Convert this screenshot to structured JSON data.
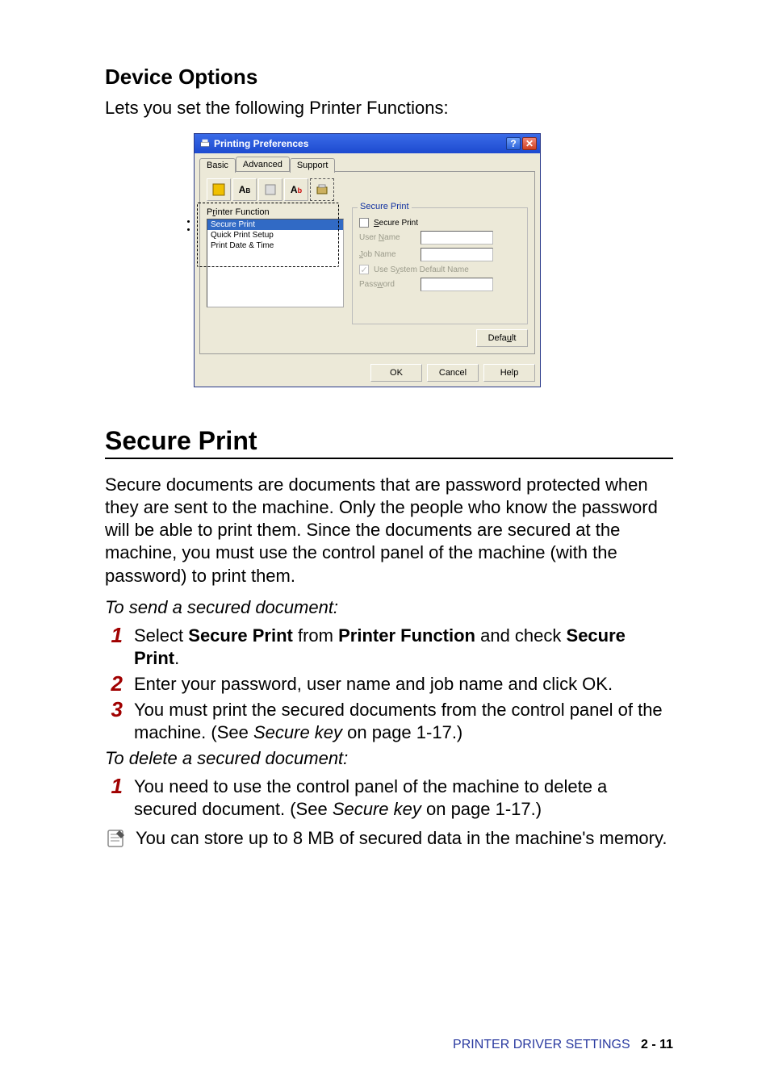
{
  "headings": {
    "device_options": "Device Options",
    "secure_print": "Secure Print"
  },
  "intro": "Lets you set the following Printer Functions:",
  "dialog": {
    "title": "Printing Preferences",
    "tabs": {
      "basic": "Basic",
      "advanced": "Advanced",
      "support": "Support"
    },
    "printer_function_label_pre": "P",
    "printer_function_label_ul": "r",
    "printer_function_label_post": "inter Function",
    "list": {
      "secure_print": "Secure Print",
      "quick_print_setup": "Quick Print Setup",
      "print_date_time": "Print Date & Time"
    },
    "group": {
      "legend": "Secure Print",
      "secure_print_chk_pre": "",
      "secure_print_chk_ul": "S",
      "secure_print_chk_post": "ecure Print",
      "user_name_pre": "User ",
      "user_name_ul": "N",
      "user_name_post": "ame",
      "job_name_pre": "",
      "job_name_ul": "J",
      "job_name_post": "ob Name",
      "use_default_pre": "Use S",
      "use_default_ul": "y",
      "use_default_post": "stem Default Name",
      "password_pre": "Pass",
      "password_ul": "w",
      "password_post": "ord"
    },
    "buttons": {
      "default": "Defa",
      "default_ul": "u",
      "default_post": "lt",
      "ok": "OK",
      "cancel": "Cancel",
      "help": "Help"
    }
  },
  "secure_para": "Secure documents are documents that are password protected when they are sent to the machine. Only the people who know the password will be able to print them. Since the documents are secured at the machine, you must use the control panel of the machine (with the password) to print them.",
  "send_title": "To send a secured document:",
  "send_steps": {
    "s1_a": "Select ",
    "s1_b1": "Secure Print",
    "s1_c": " from ",
    "s1_b2": "Printer Function",
    "s1_d": " and check ",
    "s1_b3": "Secure Print",
    "s1_e": ".",
    "s2": "Enter your password, user name and job name and click OK.",
    "s3_a": "You must print the secured documents from the control panel of the machine. (See ",
    "s3_ref": "Secure key",
    "s3_b": " on page 1-17.)"
  },
  "delete_title": "To delete a secured document:",
  "delete_steps": {
    "d1_a": "You need to use the control panel of the machine to delete a secured document. (See ",
    "d1_ref": "Secure key",
    "d1_b": " on page 1-17.)"
  },
  "note": "You can store up to 8 MB of secured data in the machine's memory.",
  "footer": {
    "section": "PRINTER DRIVER SETTINGS",
    "page": "2 - 11"
  },
  "nums": {
    "one": "1",
    "two": "2",
    "three": "3"
  }
}
